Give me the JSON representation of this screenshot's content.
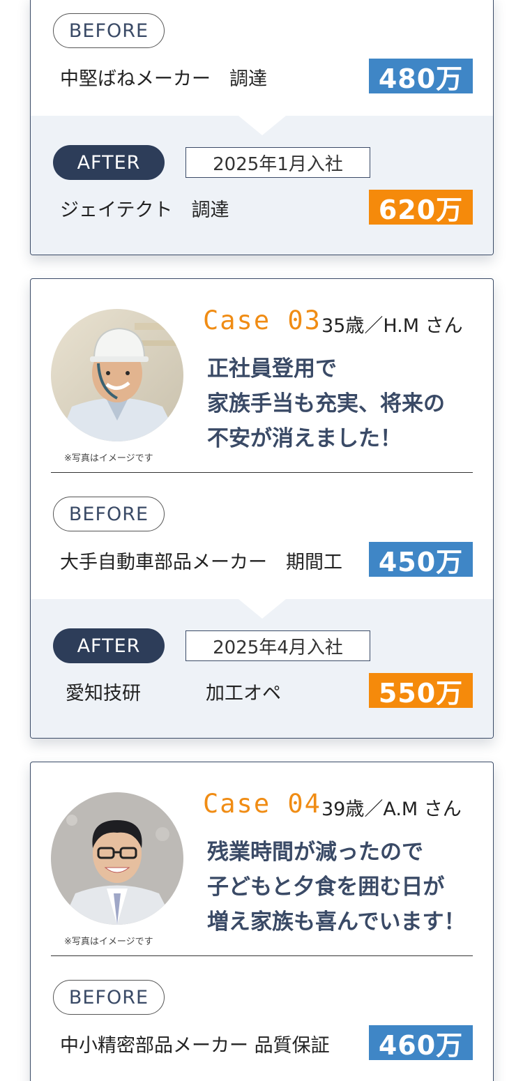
{
  "cases": {
    "case02": {
      "before": {
        "label": "BEFORE",
        "company": "中堅ばねメーカー　調達",
        "salary": "480万"
      },
      "after": {
        "label": "AFTER",
        "joined": "2025年1月入社",
        "company": "ジェイテクト　調達",
        "salary": "620万"
      }
    },
    "case03": {
      "case_label": "Case 03",
      "person": "35歳／H.M さん",
      "quote": [
        "正社員登用で",
        "家族手当も充実、将来の",
        "不安が消えました！"
      ],
      "photo_note": "※写真はイメージです",
      "before": {
        "label": "BEFORE",
        "company": "大手自動車部品メーカー　期間工",
        "salary": "450万"
      },
      "after": {
        "label": "AFTER",
        "joined": "2025年4月入社",
        "company": "愛知技研",
        "role": "加工オペ",
        "salary": "550万"
      }
    },
    "case04": {
      "case_label": "Case 04",
      "person": "39歳／A.M さん",
      "quote": [
        "残業時間が減ったので",
        "子どもと夕食を囲む日が",
        "増え家族も喜んでいます！"
      ],
      "photo_note": "※写真はイメージです",
      "before": {
        "label": "BEFORE",
        "company": "中小精密部品メーカー 品質保証",
        "salary": "460万"
      }
    }
  },
  "colors": {
    "navy": "#2d3d59",
    "orange": "#f58a0b",
    "blue": "#3f86c6",
    "after_bg": "#eef2f7",
    "case_orange": "#f08c14"
  },
  "icons": {
    "case03_photo": "worker-helmet-photo",
    "case04_photo": "worker-glasses-photo"
  }
}
